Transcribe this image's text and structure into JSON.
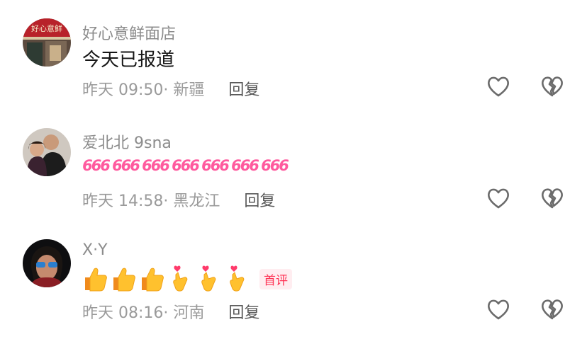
{
  "comments": [
    {
      "username": "好心意鲜面店",
      "content": "今天已报道",
      "time_location": "昨天 09:50· 新疆",
      "reply_label": "回复",
      "avatar_sign": "好心意鲜"
    },
    {
      "username": "爱北北 9sna",
      "emoji_text": [
        "666",
        "666",
        "666",
        "666",
        "666",
        "666",
        "666"
      ],
      "time_location": "昨天 14:58· 黑龙江",
      "reply_label": "回复"
    },
    {
      "username": "X·Y",
      "emojis": [
        "thumbs-up",
        "thumbs-up",
        "thumbs-up",
        "heart-fingers",
        "heart-fingers",
        "heart-fingers"
      ],
      "badge": "首评",
      "time_location": "昨天 08:16· 河南",
      "reply_label": "回复"
    }
  ],
  "icons": {
    "like": "heart-outline-icon",
    "dislike": "broken-heart-icon"
  },
  "colors": {
    "username": "#8c8c8c",
    "content": "#161616",
    "meta": "#9a9a9a",
    "badge_text": "#ff3355",
    "badge_bg": "#ffedf0",
    "emoji_666": "#ff5a9e"
  }
}
